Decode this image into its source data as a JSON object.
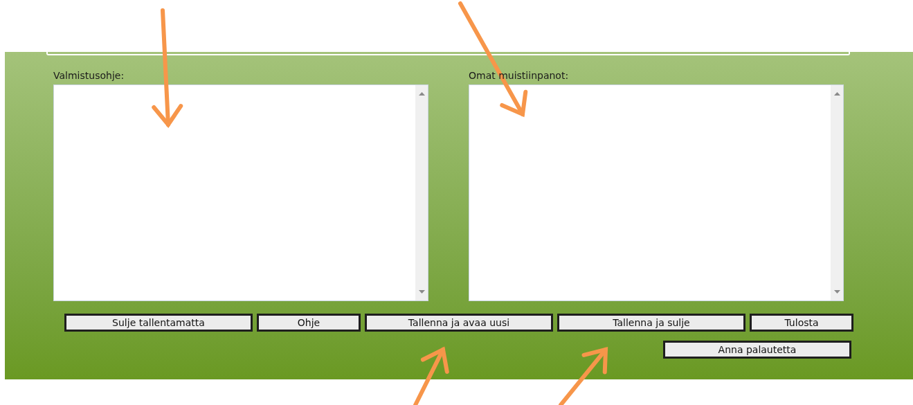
{
  "fields": [
    {
      "label": "Valmistusohje:"
    },
    {
      "label": "Omat muistiinpanot:"
    }
  ],
  "buttons": [
    {
      "label": "Sulje tallentamatta"
    },
    {
      "label": "Ohje"
    },
    {
      "label": "Tallenna ja avaa uusi"
    },
    {
      "label": "Tallenna ja sulje"
    },
    {
      "label": "Tulosta"
    }
  ],
  "feedback_button": {
    "label": "Anna palautetta"
  }
}
